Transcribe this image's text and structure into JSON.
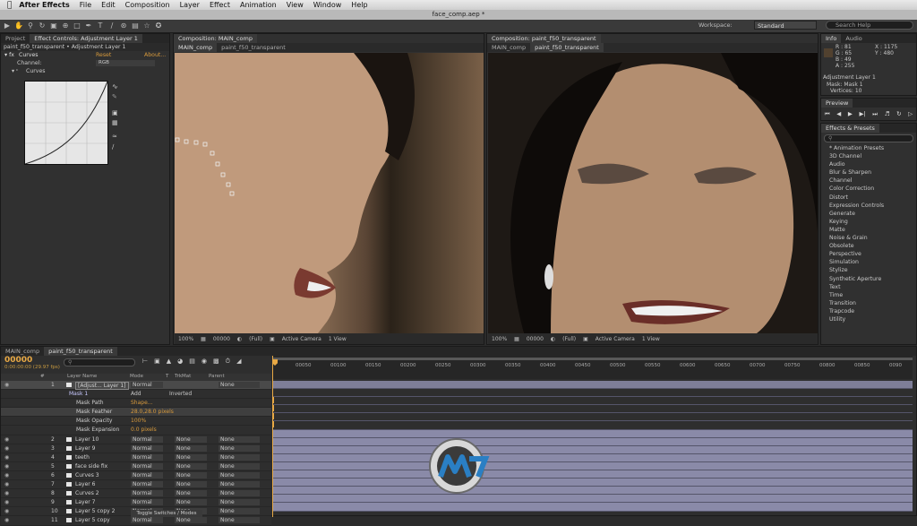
{
  "menubar": {
    "apple": "",
    "app": "After Effects",
    "items": [
      "File",
      "Edit",
      "Composition",
      "Layer",
      "Effect",
      "Animation",
      "View",
      "Window",
      "Help"
    ]
  },
  "window": {
    "title": "face_comp.aep *"
  },
  "workspace": {
    "label": "Workspace:",
    "value": "Standard"
  },
  "search_help": {
    "placeholder": "Search Help"
  },
  "project_panel": {
    "tabs": [
      "Project",
      "Effect Controls: Adjustment Layer 1"
    ],
    "breadcrumb": "paint_f50_transparent • Adjustment Layer 1",
    "effect_name": "Curves",
    "reset": "Reset",
    "about": "About...",
    "channel_label": "Channel:",
    "channel_value": "RGB",
    "curves_label": "Curves"
  },
  "comp_left": {
    "tab": "Composition: MAIN_comp",
    "subtabs": [
      "MAIN_comp",
      "paint_f50_transparent"
    ],
    "zoom": "100%",
    "timecode": "00000",
    "resolution": "(Full)",
    "camera": "Active Camera",
    "view": "1 View"
  },
  "comp_right": {
    "tab": "Composition: paint_f50_transparent",
    "subtabs": [
      "MAIN_comp",
      "paint_f50_transparent"
    ],
    "zoom": "100%",
    "timecode": "00000",
    "resolution": "(Full)",
    "camera": "Active Camera",
    "view": "1 View"
  },
  "info_panel": {
    "tabs": [
      "Info",
      "Audio"
    ],
    "r": "R : 81",
    "g": "G : 65",
    "b": "B : 49",
    "a": "A : 255",
    "x": "X : 1175",
    "y": "Y : 480",
    "layer": "Adjustment Layer 1",
    "mask": "Mask: Mask 1",
    "vertices": "Vertices: 10"
  },
  "preview_panel": {
    "tab": "Preview"
  },
  "effects_panel": {
    "tab": "Effects & Presets",
    "search": "",
    "items": [
      "* Animation Presets",
      "3D Channel",
      "Audio",
      "Blur & Sharpen",
      "Channel",
      "Color Correction",
      "Distort",
      "Expression Controls",
      "Generate",
      "Keying",
      "Matte",
      "Noise & Grain",
      "Obsolete",
      "Perspective",
      "Simulation",
      "Stylize",
      "Synthetic Aperture",
      "Text",
      "Time",
      "Transition",
      "Trapcode",
      "Utility"
    ]
  },
  "timeline": {
    "tabs": [
      "MAIN_comp",
      "paint_f50_transparent"
    ],
    "timecode": "00000",
    "timecode_sub": "0:00:00:00 (29.97 fps)",
    "columns": {
      "num": "#",
      "name": "Layer Name",
      "mode": "Mode",
      "t": "T",
      "trkmat": "TrkMat",
      "parent": "Parent"
    },
    "ruler": [
      "00050",
      "00100",
      "00150",
      "00200",
      "00250",
      "00300",
      "00350",
      "00400",
      "00450",
      "00500",
      "00550",
      "00600",
      "00650",
      "00700",
      "00750",
      "00800",
      "00850",
      "0090"
    ],
    "rows": [
      {
        "num": "1",
        "name": "[Adjust... Layer 1]",
        "mode": "Normal",
        "trkmat": "",
        "parent": "None"
      },
      {
        "num": "",
        "name": "Mask 1",
        "mode": "Add",
        "trkmat": "Inverted",
        "parent": ""
      },
      {
        "num": "",
        "name": "Mask Path",
        "mode": "Shape...",
        "trkmat": "",
        "parent": ""
      },
      {
        "num": "",
        "name": "Mask Feather",
        "mode": "28.0,28.0 pixels",
        "trkmat": "",
        "parent": ""
      },
      {
        "num": "",
        "name": "Mask Opacity",
        "mode": "100%",
        "trkmat": "",
        "parent": ""
      },
      {
        "num": "",
        "name": "Mask Expansion",
        "mode": "0.0 pixels",
        "trkmat": "",
        "parent": ""
      },
      {
        "num": "2",
        "name": "Layer 10",
        "mode": "Normal",
        "trkmat": "None",
        "parent": "None"
      },
      {
        "num": "3",
        "name": "Layer 9",
        "mode": "Normal",
        "trkmat": "None",
        "parent": "None"
      },
      {
        "num": "4",
        "name": "teeth",
        "mode": "Normal",
        "trkmat": "None",
        "parent": "None"
      },
      {
        "num": "5",
        "name": "face side fix",
        "mode": "Normal",
        "trkmat": "None",
        "parent": "None"
      },
      {
        "num": "6",
        "name": "Curves 3",
        "mode": "Normal",
        "trkmat": "None",
        "parent": "None"
      },
      {
        "num": "7",
        "name": "Layer 6",
        "mode": "Normal",
        "trkmat": "None",
        "parent": "None"
      },
      {
        "num": "8",
        "name": "Curves 2",
        "mode": "Normal",
        "trkmat": "None",
        "parent": "None"
      },
      {
        "num": "9",
        "name": "Layer 7",
        "mode": "Normal",
        "trkmat": "None",
        "parent": "None"
      },
      {
        "num": "10",
        "name": "Layer 5 copy 2",
        "mode": "Normal",
        "trkmat": "None",
        "parent": "None"
      },
      {
        "num": "11",
        "name": "Layer 5 copy",
        "mode": "Normal",
        "trkmat": "None",
        "parent": "None"
      }
    ],
    "toggle": "Toggle Switches / Modes"
  },
  "colors": {
    "accent": "#d89a3c",
    "track": "#8a8aa8",
    "highlight": "#4a4a4a"
  }
}
